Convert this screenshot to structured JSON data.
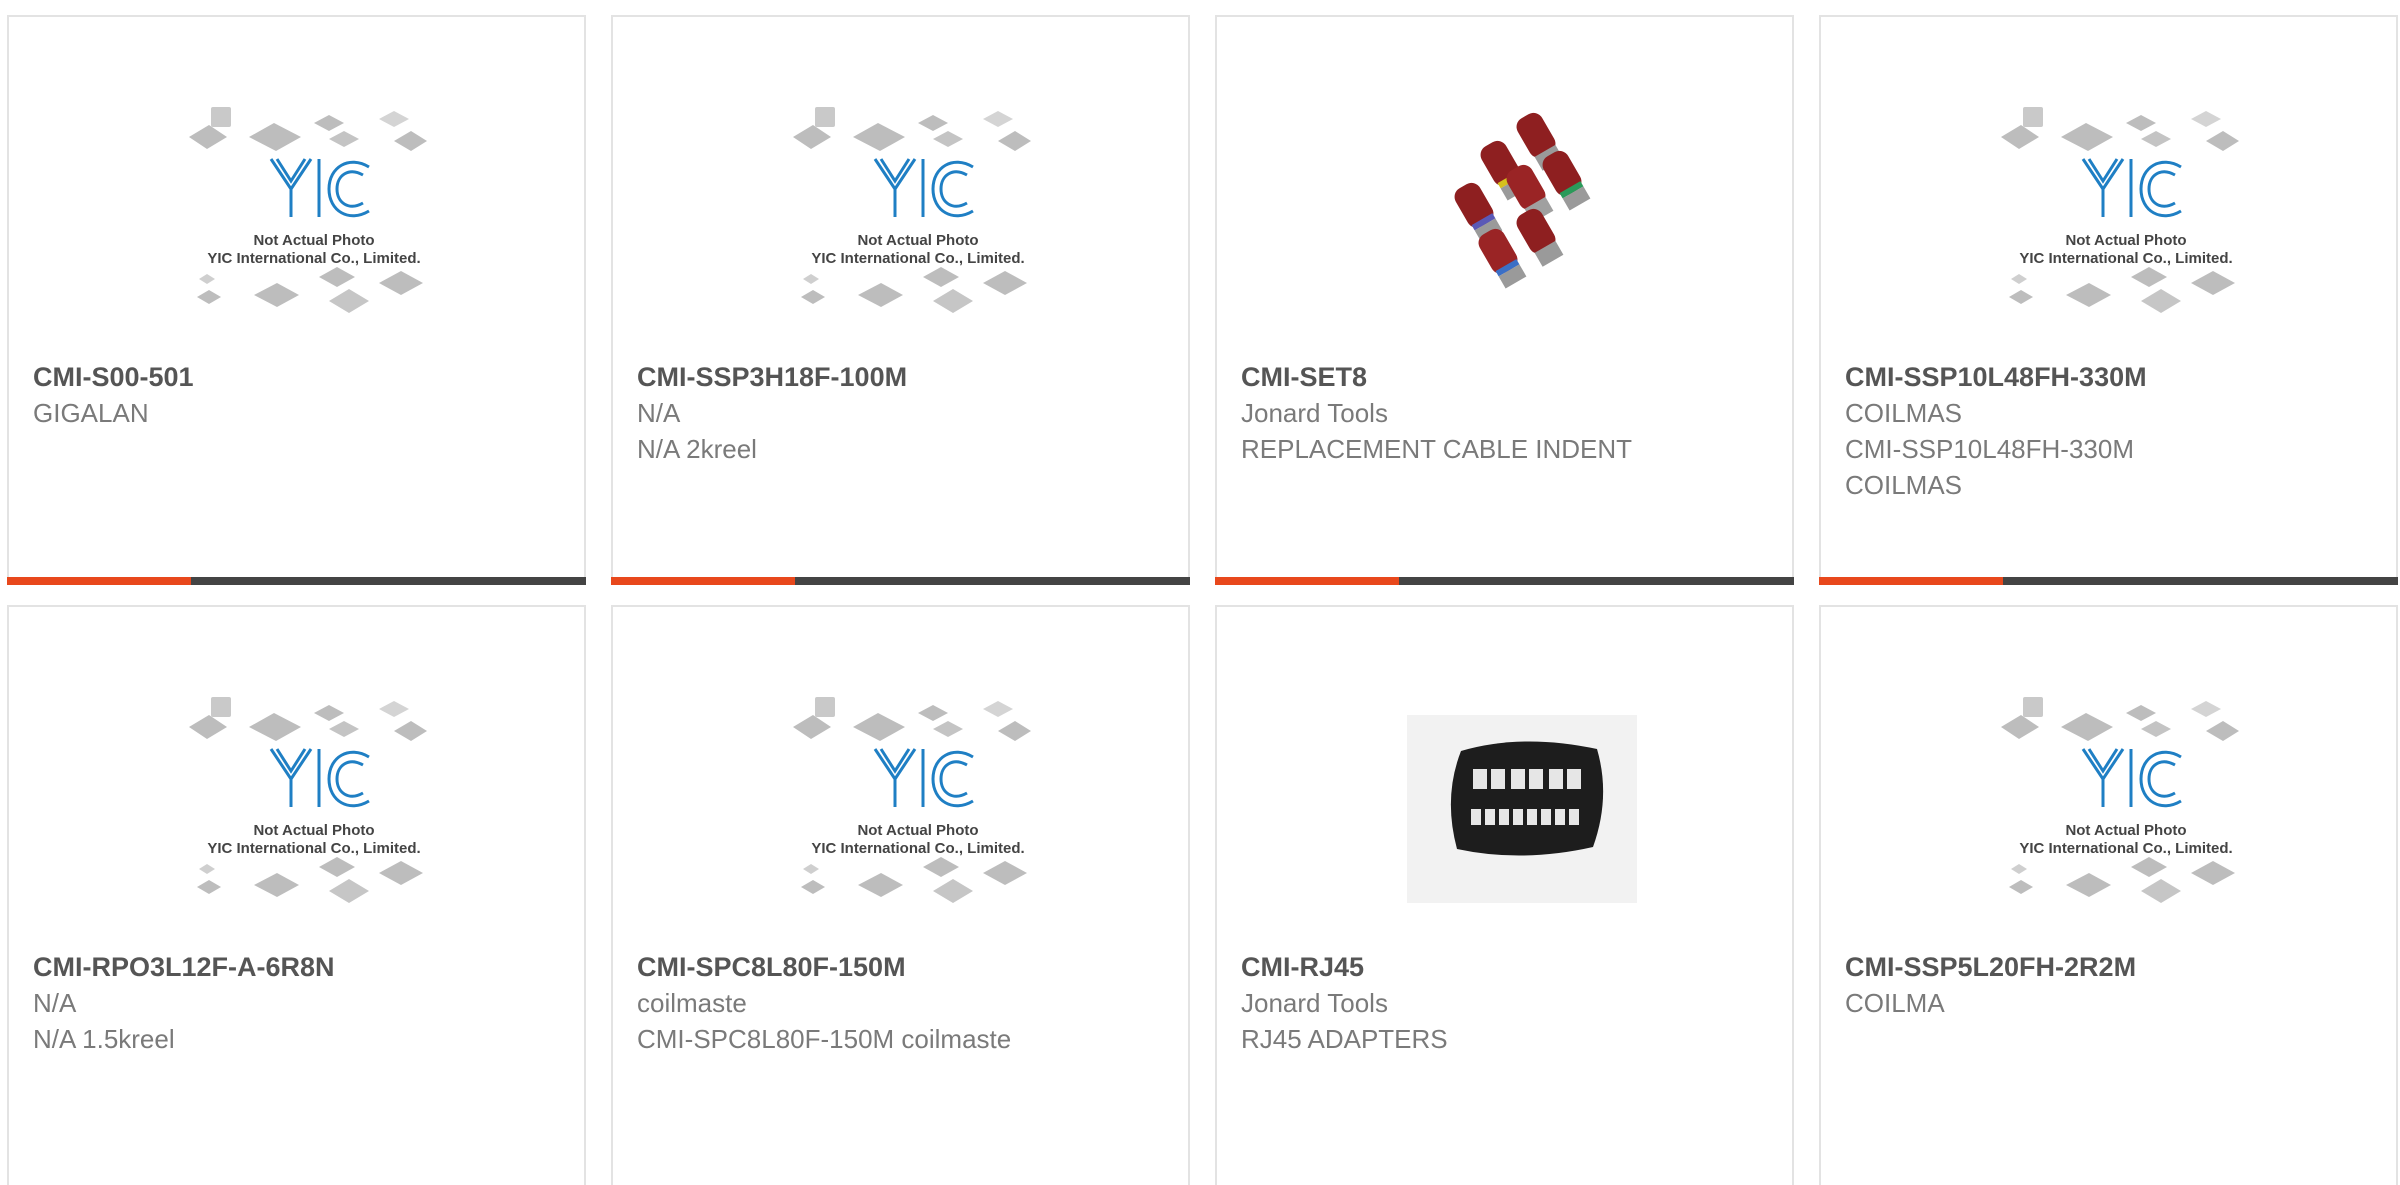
{
  "products": [
    {
      "part_number": "CMI-S00-501",
      "manufacturer": "GIGALAN",
      "description": "",
      "image": "placeholder"
    },
    {
      "part_number": "CMI-SSP3H18F-100M",
      "manufacturer": "N/A",
      "description": "N/A 2kreel",
      "image": "placeholder"
    },
    {
      "part_number": "CMI-SET8",
      "manufacturer": "Jonard Tools",
      "description": "REPLACEMENT CABLE INDENT",
      "image": "cable-connectors-photo"
    },
    {
      "part_number": "CMI-SSP10L48FH-330M",
      "manufacturer": "COILMAS",
      "description": "CMI-SSP10L48FH-330M",
      "description2": "COILMAS",
      "image": "placeholder"
    },
    {
      "part_number": "CMI-RPO3L12F-A-6R8N",
      "manufacturer": "N/A",
      "description": "N/A 1.5kreel",
      "image": "placeholder"
    },
    {
      "part_number": "CMI-SPC8L80F-150M",
      "manufacturer": "coilmaste",
      "description": "CMI-SPC8L80F-150M coilmaste",
      "image": "placeholder"
    },
    {
      "part_number": "CMI-RJ45",
      "manufacturer": "Jonard Tools",
      "description": "RJ45 ADAPTERS",
      "image": "rj45-adapter-kit-photo"
    },
    {
      "part_number": "CMI-SSP5L20FH-2R2M",
      "manufacturer": "COILMA",
      "description": "",
      "image": "placeholder"
    }
  ],
  "placeholder_image": {
    "logo_text": "YIC",
    "caption_line1": "Not Actual Photo",
    "caption_line2": "YIC International Co., Limited."
  },
  "colors": {
    "accent": "#e8481c",
    "bar": "#444444",
    "logo_blue": "#1f7fc4",
    "part_number_text": "#555555",
    "secondary_text": "#7a7a7a"
  }
}
